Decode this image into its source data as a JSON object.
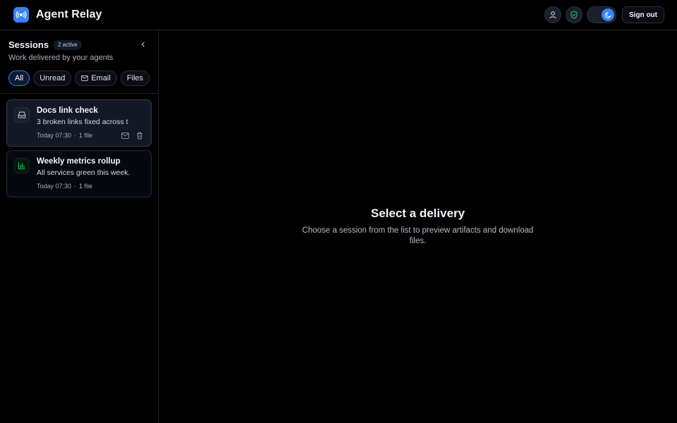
{
  "app": {
    "title": "Agent Relay"
  },
  "header": {
    "icons": [
      "user-icon",
      "shield-check-icon",
      "moon-icon"
    ],
    "sign_out_label": "Sign out"
  },
  "sidebar": {
    "title": "Sessions",
    "badge": "2 active",
    "subtitle": "Work delivered by your agents",
    "filters": [
      {
        "label": "All",
        "active": true
      },
      {
        "label": "Unread",
        "active": false
      },
      {
        "label": "Email",
        "icon": "mail-icon",
        "active": false
      },
      {
        "label": "Files",
        "active": false
      }
    ],
    "sessions": [
      {
        "title": "Docs link check",
        "preview": "3 broken links fixed across t...",
        "time": "Today 07:30",
        "files": "1 file",
        "icon": "inbox-icon",
        "selected": true
      },
      {
        "title": "Weekly metrics rollup",
        "preview": "All services green this week.",
        "time": "Today 07:30",
        "files": "1 file",
        "icon": "bar-chart-icon",
        "selected": false
      }
    ]
  },
  "main": {
    "empty_title": "Select a delivery",
    "empty_description": "Choose a session from the list to preview artifacts and download files."
  },
  "colors": {
    "background": "#000000",
    "accent": "#3b82f6",
    "success": "#22c55e",
    "border": "#1c2233"
  }
}
